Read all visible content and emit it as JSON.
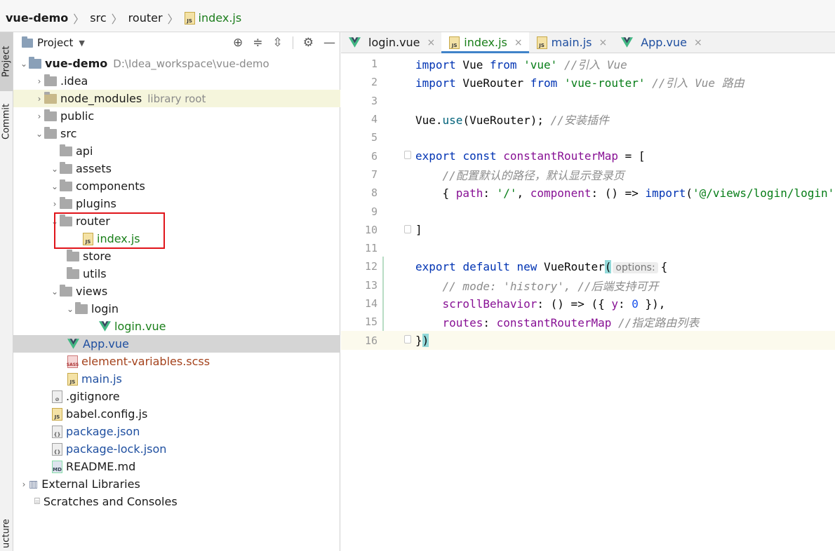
{
  "breadcrumb": {
    "project": "vue-demo",
    "src": "src",
    "router": "router",
    "file": "index.js"
  },
  "left_strip": {
    "project_tab": "Project",
    "commit_tab": "Commit",
    "structure_tab": "ucture"
  },
  "project_panel": {
    "title": "Project",
    "tree": [
      {
        "label": "vue-demo",
        "path": "D:\\Idea_workspace\\vue-demo"
      },
      {
        "label": ".idea"
      },
      {
        "label": "node_modules",
        "note": "library root"
      },
      {
        "label": "public"
      },
      {
        "label": "src"
      },
      {
        "label": "api"
      },
      {
        "label": "assets"
      },
      {
        "label": "components"
      },
      {
        "label": "plugins"
      },
      {
        "label": "router"
      },
      {
        "label": "index.js"
      },
      {
        "label": "store"
      },
      {
        "label": "utils"
      },
      {
        "label": "views"
      },
      {
        "label": "login"
      },
      {
        "label": "login.vue"
      },
      {
        "label": "App.vue"
      },
      {
        "label": "element-variables.scss"
      },
      {
        "label": "main.js"
      },
      {
        "label": ".gitignore"
      },
      {
        "label": "babel.config.js"
      },
      {
        "label": "package.json"
      },
      {
        "label": "package-lock.json"
      },
      {
        "label": "README.md"
      },
      {
        "label": "External Libraries"
      },
      {
        "label": "Scratches and Consoles"
      }
    ]
  },
  "editor": {
    "tabs": [
      {
        "label": "login.vue"
      },
      {
        "label": "index.js"
      },
      {
        "label": "main.js"
      },
      {
        "label": "App.vue"
      }
    ],
    "close_glyph": "×",
    "code": {
      "l1": {
        "a": "import",
        "b": " Vue ",
        "c": "from",
        "d": " ",
        "e": "'vue'",
        "f": " //引入 Vue"
      },
      "l2": {
        "a": "import",
        "b": " VueRouter ",
        "c": "from",
        "d": " ",
        "e": "'vue-router'",
        "f": " //引入 Vue 路由"
      },
      "l4": {
        "a": "Vue.",
        "b": "use",
        "c": "(VueRouter); ",
        "d": "//安装插件"
      },
      "l6": {
        "a": "export",
        "b": " ",
        "c": "const",
        "d": " ",
        "e": "constantRouterMap",
        "f": " = ["
      },
      "l7": {
        "a": "    //配置默认的路径，默认显示登录页"
      },
      "l8": {
        "a": "    { ",
        "b": "path",
        "c": ": ",
        "d": "'/'",
        "e": ", ",
        "f": "component",
        "g": ": () => ",
        "h": "import",
        "i": "(",
        "j": "'@/views/login/login'",
        "k": ")"
      },
      "l10": {
        "a": "]"
      },
      "l12": {
        "a": "export",
        "b": " ",
        "c": "default",
        "d": " ",
        "e": "new",
        "f": " VueRouter",
        "g": "(",
        "hint": "options:",
        "h": "{"
      },
      "l13": {
        "a": "    // mode: 'history', //后端支持可开"
      },
      "l14": {
        "a": "    ",
        "b": "scrollBehavior",
        "c": ": () => ({ ",
        "d": "y",
        "e": ": ",
        "f": "0",
        "g": " }),"
      },
      "l15": {
        "a": "    ",
        "b": "routes",
        "c": ": ",
        "d": "constantRouterMap",
        "e": " ",
        "f": "//指定路由列表"
      },
      "l16": {
        "a": "}",
        "b": ")"
      }
    },
    "line_numbers": [
      "1",
      "2",
      "3",
      "4",
      "5",
      "6",
      "7",
      "8",
      "9",
      "10",
      "11",
      "12",
      "13",
      "14",
      "15",
      "16"
    ]
  }
}
